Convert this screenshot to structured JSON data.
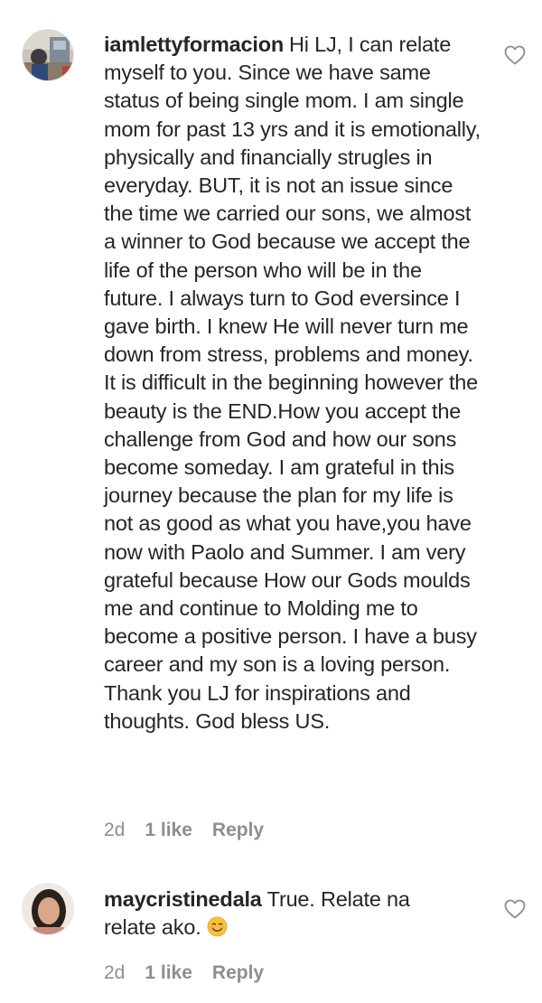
{
  "comments": [
    {
      "username": "iamlettyformacion",
      "text": "Hi LJ, I can relate myself to you. Since we have same status of being single mom. I am single mom for past 13 yrs and it is emotionally, physically and financially strugles in everyday. BUT, it is not an issue since the time we carried our sons, we almost a winner to God because we accept the life of the person who will be in the future. I always turn to God eversince I gave birth. I knew He will never turn me down from stress, problems and money. It is difficult in the beginning however the beauty is the END.How you accept the challenge from God and how our sons become someday. I am grateful in this journey because the plan for my life is not as good as what you have,you have now with Paolo and Summer. I am very grateful because How our Gods moulds me and continue to Molding me to become a positive person. I have a busy career and my son is a loving person. Thank you LJ for inspirations and thoughts. God bless US.",
      "time": "2d",
      "likes": "1 like",
      "reply_label": "Reply",
      "like_icon": "heart-outline-icon"
    },
    {
      "username": "maycristinedala",
      "text": "True. Relate na relate ako.",
      "emoji": "smiling-face-emoji",
      "time": "2d",
      "likes": "1 like",
      "reply_label": "Reply",
      "like_icon": "heart-outline-icon"
    }
  ],
  "colors": {
    "text": "#262626",
    "secondary": "#8e8e8e",
    "emoji": "#f7c23a"
  }
}
